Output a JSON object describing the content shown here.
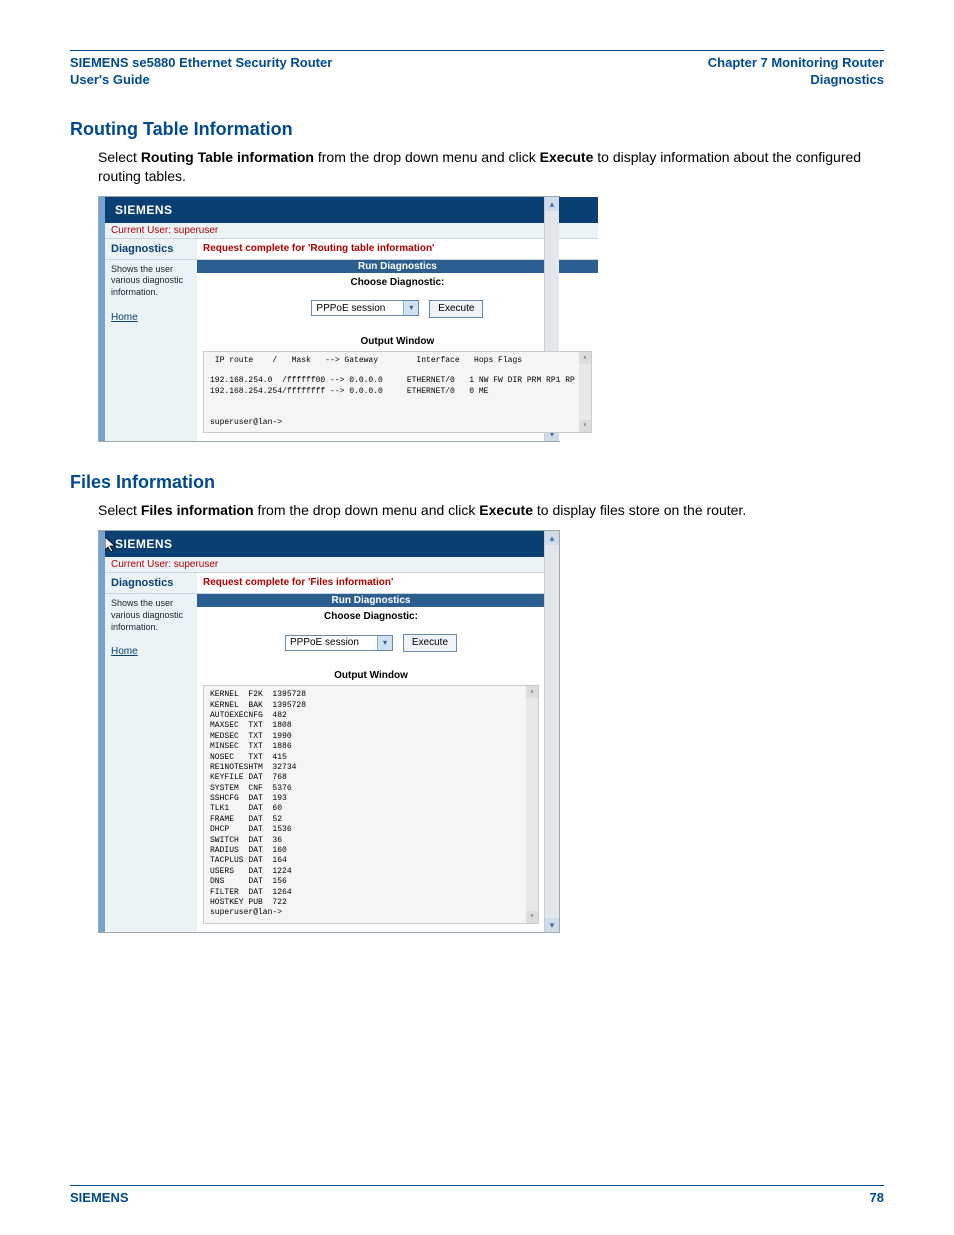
{
  "header": {
    "left_line1": "SIEMENS se5880 Ethernet Security Router",
    "left_line2": "User's Guide",
    "right_line1": "Chapter 7  Monitoring Router",
    "right_line2": "Diagnostics"
  },
  "section1": {
    "heading": "Routing Table Information",
    "body_pre": "Select ",
    "body_bold1": "Routing Table information",
    "body_mid": " from the drop down menu and click ",
    "body_bold2": "Execute",
    "body_post": " to display information about the configured routing tables.",
    "shot": {
      "brand": "SIEMENS",
      "current_user": "Current User: superuser",
      "diag_label": "Diagnostics",
      "status": "Request complete for 'Routing table information'",
      "sidebar_desc": "Shows the user various diagnostic information.",
      "home": "Home",
      "run_diag": "Run Diagnostics",
      "choose_diag": "Choose Diagnostic:",
      "select_value": "PPPoE session",
      "execute": "Execute",
      "output_label": "Output Window",
      "output_text": " IP route    /   Mask   --> Gateway        Interface   Hops Flags\n\n192.168.254.0  /ffffff00 --> 0.0.0.0     ETHERNET/0   1 NW FW DIR PRM RP1 RP\n192.168.254.254/ffffffff --> 0.0.0.0     ETHERNET/0   0 ME\n\n\nsuperuser@lan->"
    }
  },
  "section2": {
    "heading": "Files Information",
    "body_pre": "Select ",
    "body_bold1": "Files information",
    "body_mid": " from the drop down menu and click ",
    "body_bold2": "Execute",
    "body_post": " to display files store on the router.",
    "shot": {
      "brand": "SIEMENS",
      "current_user": "Current User: superuser",
      "diag_label": "Diagnostics",
      "status": "Request complete for 'Files information'",
      "sidebar_desc": "Shows the user various diagnostic information.",
      "home": "Home",
      "run_diag": "Run Diagnostics",
      "choose_diag": "Choose Diagnostic:",
      "select_value": "PPPoE session",
      "execute": "Execute",
      "output_label": "Output Window",
      "output_text": "KERNEL  F2K  1395728\nKERNEL  BAK  1395728\nAUTOEXECNFG  482\nMAXSEC  TXT  1808\nMEDSEC  TXT  1990\nMINSEC  TXT  1886\nNOSEC   TXT  415\nRE1NOTESHTM  32734\nKEYFILE DAT  768\nSYSTEM  CNF  5376\nSSHCFG  DAT  193\nTLK1    DAT  60\nFRAME   DAT  52\nDHCP    DAT  1536\nSWITCH  DAT  36\nRADIUS  DAT  160\nTACPLUS DAT  164\nUSERS   DAT  1224\nDNS     DAT  156\nFILTER  DAT  1264\nHOSTKEY PUB  722\nsuperuser@lan->"
    }
  },
  "footer": {
    "left": "SIEMENS",
    "right": "78"
  }
}
